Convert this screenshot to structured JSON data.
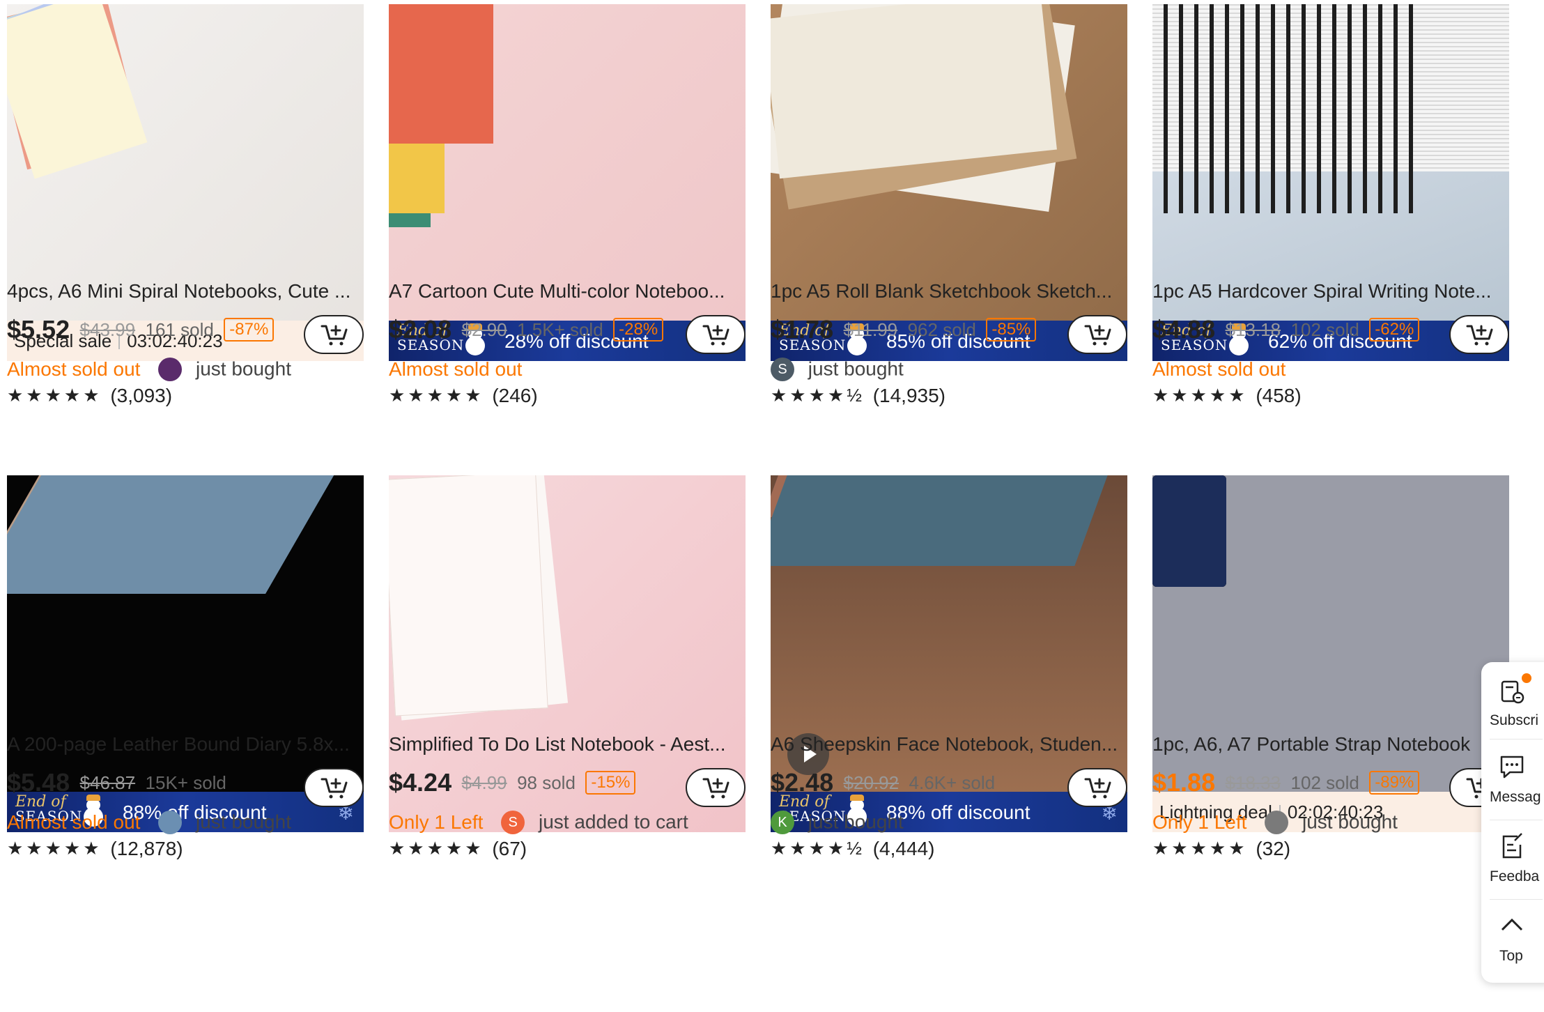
{
  "products": [
    {
      "title": "4pcs, A6 Mini Spiral Notebooks, Cute ...",
      "banner": {
        "type": "sale",
        "label": "Special sale",
        "timer": "03:02:40:23"
      },
      "price": "$5.52",
      "orig": "$43.99",
      "sold": "161 sold",
      "discount": "-87%",
      "almost": "Almost sold out",
      "avatar": {
        "text": "",
        "color": "#5a2b6b"
      },
      "activity": "just bought",
      "stars": "★★★★★",
      "reviews": "(3,093)",
      "price_color": "dark"
    },
    {
      "title": "A7 Cartoon Cute Multi-color Noteboo...",
      "banner": {
        "type": "season",
        "label": "28% off discount"
      },
      "price": "$2.08",
      "orig": "$2.90",
      "sold": "1.5K+ sold",
      "discount": "-28%",
      "almost": "Almost sold out",
      "avatar": null,
      "activity": "",
      "stars": "★★★★★",
      "reviews": "(246)",
      "price_color": "dark"
    },
    {
      "title": "1pc A5 Roll Blank Sketchbook Sketch...",
      "banner": {
        "type": "season",
        "label": "85% off discount"
      },
      "price": "$1.78",
      "orig": "$11.99",
      "sold": "962 sold",
      "discount": "-85%",
      "almost": "",
      "avatar": {
        "text": "S",
        "color": "#4d5b66"
      },
      "activity": "just bought",
      "stars": "★★★★½",
      "reviews": "(14,935)",
      "price_color": "dark"
    },
    {
      "title": "1pc A5 Hardcover Spiral Writing Note...",
      "banner": {
        "type": "season",
        "label": "62% off discount"
      },
      "price": "$4.88",
      "orig": "$13.18",
      "sold": "102 sold",
      "discount": "-62%",
      "almost": "Almost sold out",
      "avatar": null,
      "activity": "",
      "stars": "★★★★★",
      "reviews": "(458)",
      "price_color": "dark"
    },
    {
      "title": "A 200-page Leather Bound Diary 5.8x...",
      "banner": {
        "type": "season",
        "label": "88% off discount"
      },
      "price": "$5.48",
      "orig": "$46.87",
      "sold": "15K+ sold",
      "discount": "",
      "almost": "Almost sold out",
      "avatar": {
        "text": "",
        "color": "#6b8fb2"
      },
      "activity": "just bought",
      "stars": "★★★★★",
      "reviews": "(12,878)",
      "price_color": "dark"
    },
    {
      "title": "Simplified To Do List Notebook - Aest...",
      "banner": null,
      "price": "$4.24",
      "orig": "$4.99",
      "sold": "98 sold",
      "discount": "-15%",
      "almost": "Only 1 Left",
      "avatar": {
        "text": "S",
        "color": "#f0643c"
      },
      "activity": "just added to cart",
      "stars": "★★★★★",
      "reviews": "(67)",
      "price_color": "dark"
    },
    {
      "title": "A6 Sheepskin Face Notebook, Studen...",
      "banner": {
        "type": "season",
        "label": "88% off discount"
      },
      "price": "$2.48",
      "orig": "$20.92",
      "sold": "4.6K+ sold",
      "discount": "",
      "almost": "",
      "avatar": {
        "text": "K",
        "color": "#4f9a3c"
      },
      "activity": "just bought",
      "stars": "★★★★½",
      "reviews": "(4,444)",
      "price_color": "dark"
    },
    {
      "title": "1pc, A6, A7 Portable Strap Notebook",
      "banner": {
        "type": "sale",
        "label": "Lightning deal",
        "timer": "02:02:40:23"
      },
      "price": "$1.88",
      "orig": "$18.33",
      "sold": "102 sold",
      "discount": "-89%",
      "almost": "Only 1 Left",
      "avatar": {
        "text": "",
        "color": "#7a7a7a"
      },
      "activity": "just bought",
      "stars": "★★★★★",
      "reviews": "(32)",
      "price_color": "orange"
    }
  ],
  "side_panel": {
    "subscribe": "Subscri",
    "messages": "Messag",
    "feedback": "Feedba",
    "top": "Top"
  },
  "season_logo": {
    "line1": "End of",
    "line2": "SEASON"
  },
  "colors": {
    "accent": "#fb7701",
    "banner_blue": "#13307f",
    "sale_bg": "#fbeee4"
  }
}
